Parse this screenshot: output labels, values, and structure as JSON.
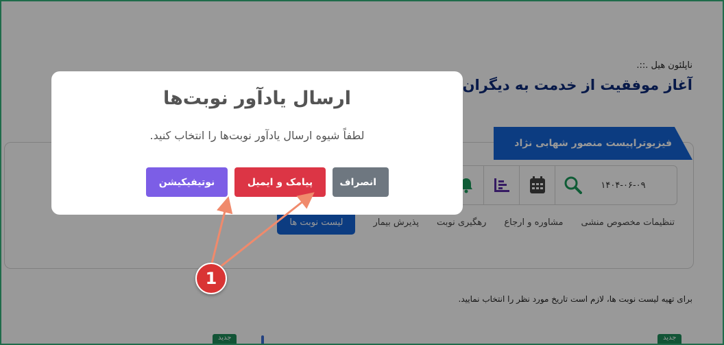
{
  "page": {
    "crumb": "ناپلئون هیل .::.",
    "headline": "آغاز موفقیت از خدمت به دیگران است",
    "doctor_ribbon": "فیزیوتراپیست منصور شهابی نژاد",
    "date": "۱۴۰۴-۰۶-۰۹",
    "toolbar_icons": [
      "search-icon",
      "calendar-icon",
      "chart-icon",
      "bell-icon"
    ],
    "tabs": [
      {
        "label": "لیست نوبت ها",
        "active": true
      },
      {
        "label": "پذیرش بیمار"
      },
      {
        "label": "رهگیری نوبت"
      },
      {
        "label": "مشاوره و ارجاع"
      },
      {
        "label": "تنظیمات مخصوص منشی"
      }
    ],
    "note": "برای تهیه لیست نوبت ها، لازم است تاریخ مورد نظر را انتخاب نمایید.",
    "badges": [
      "جدید",
      "جدید"
    ]
  },
  "modal": {
    "title": "ارسال یادآور نوبت‌ها",
    "text": "لطفاً شیوه ارسال یادآور نوبت‌ها را انتخاب کنید.",
    "buttons": {
      "notification": "نوتیفیکیشن",
      "sms_email": "پیامک و ایمیل",
      "cancel": "انصراف"
    }
  },
  "annotation": {
    "marker": "1"
  },
  "colors": {
    "primary": "#1565d8",
    "notification": "#7c5ee6",
    "sms": "#dc3545",
    "cancel": "#6e7780",
    "arrow": "#f08a6c"
  }
}
